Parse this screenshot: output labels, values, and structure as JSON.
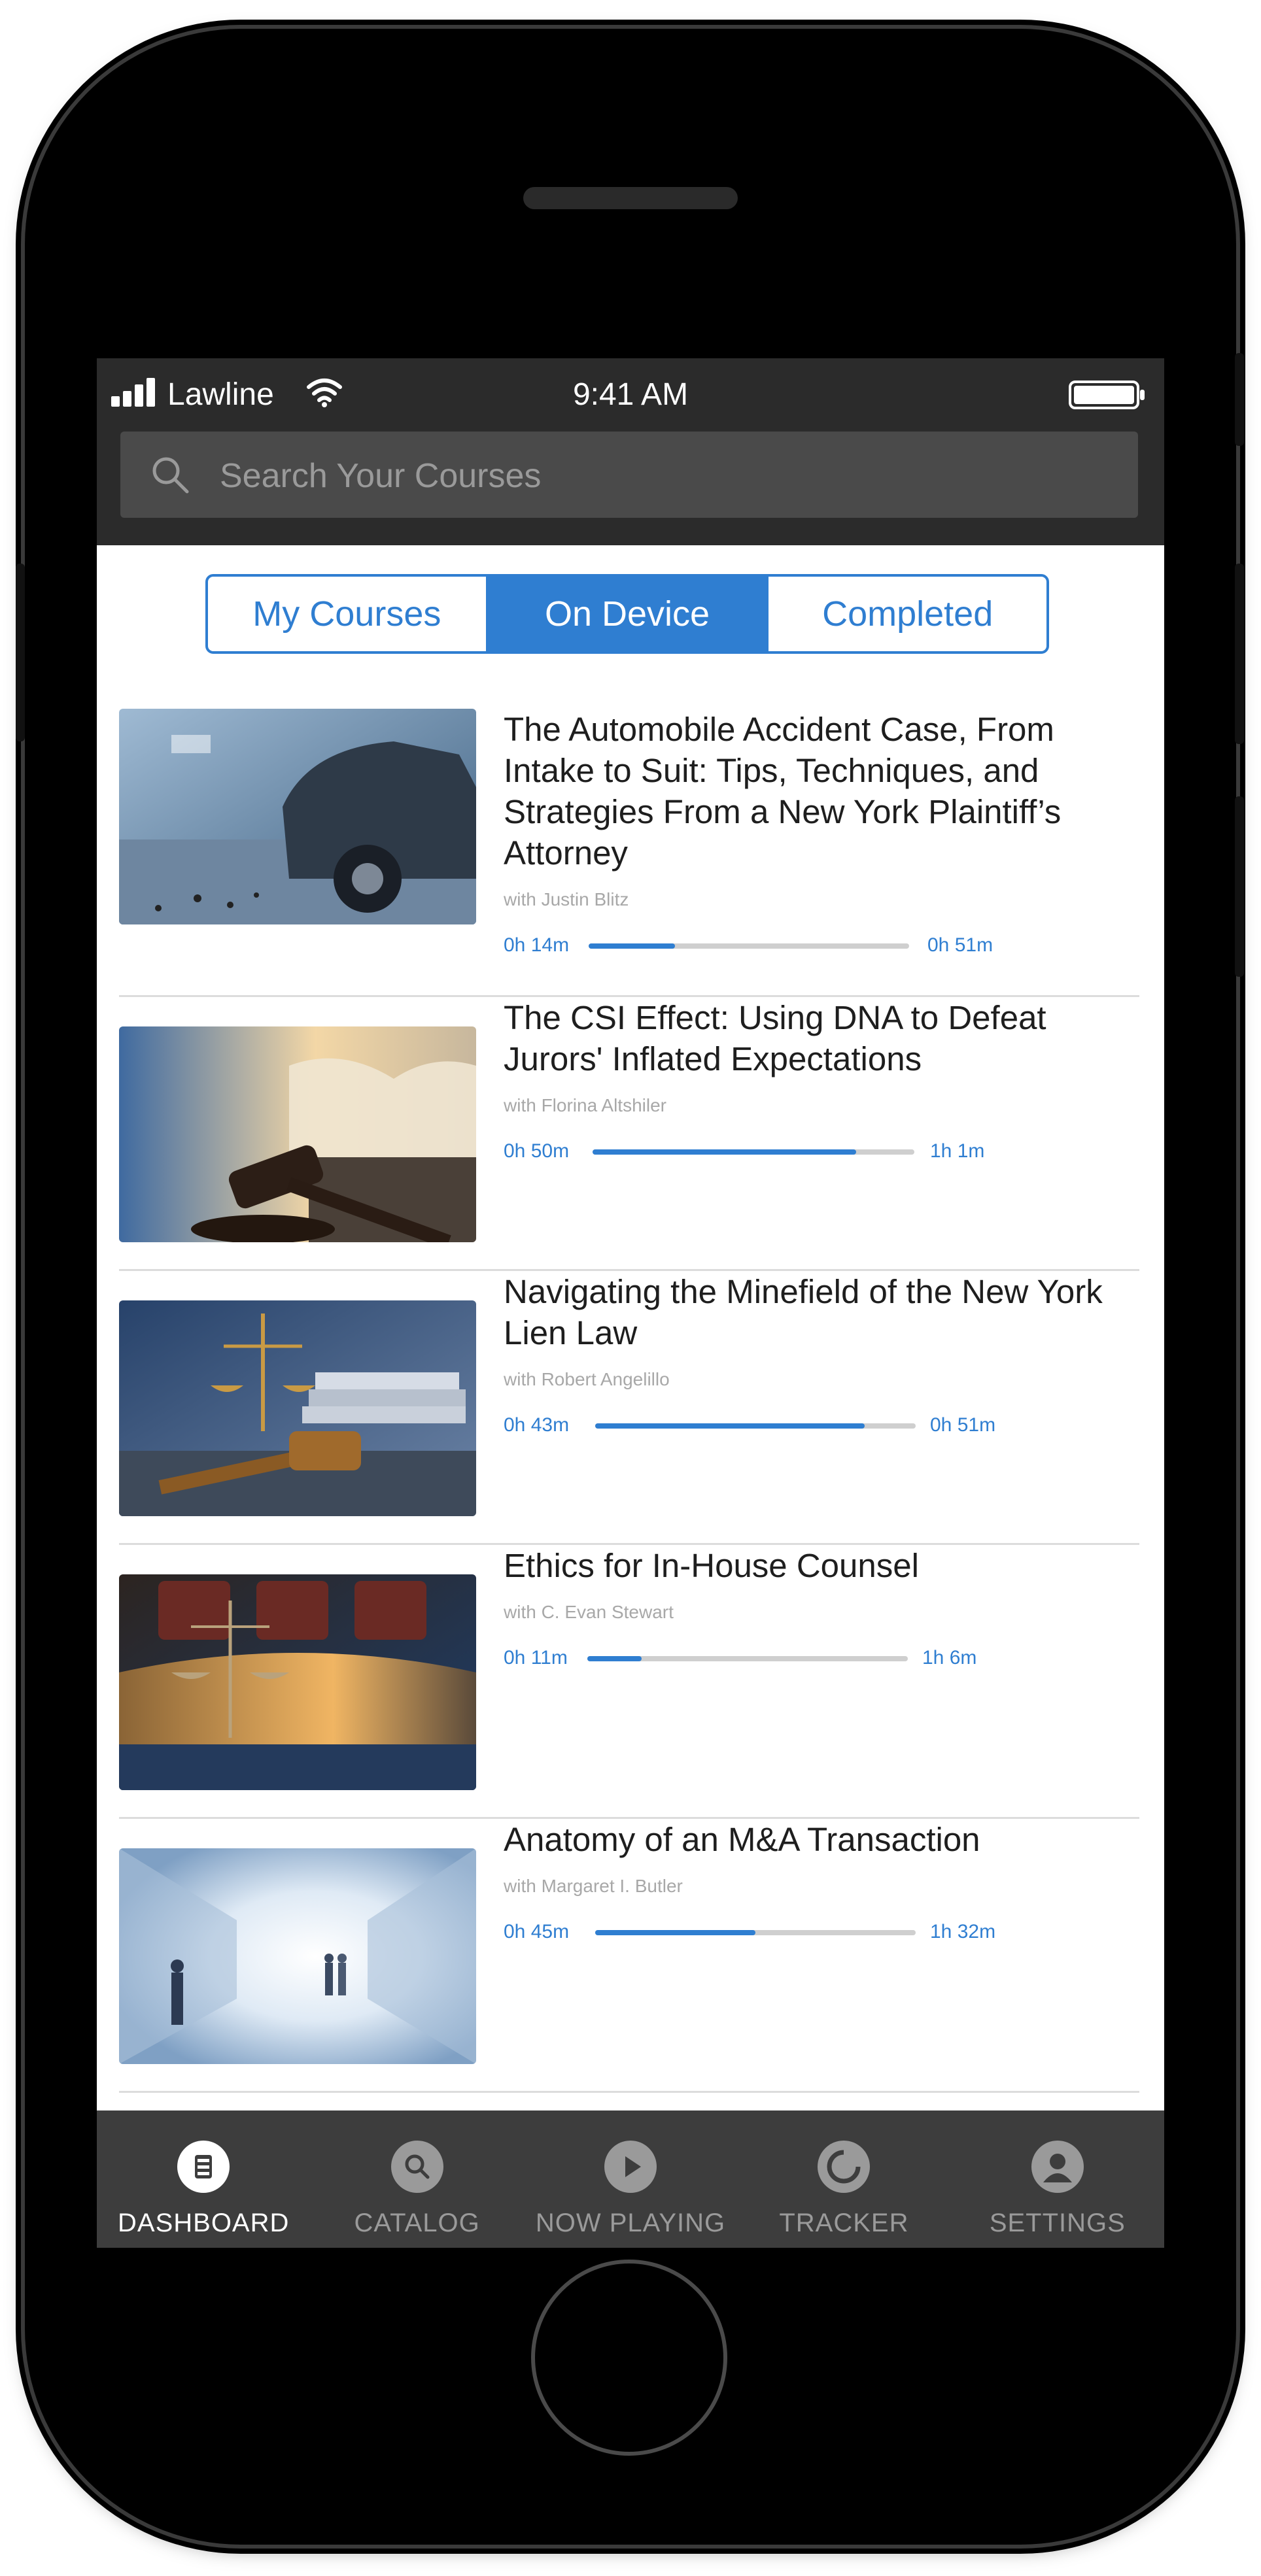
{
  "status_bar": {
    "carrier": "Lawline",
    "time": "9:41 AM"
  },
  "search": {
    "placeholder": "Search Your Courses"
  },
  "segments": [
    {
      "label": "My Courses",
      "active": false
    },
    {
      "label": "On Device",
      "active": true
    },
    {
      "label": "Completed",
      "active": false
    }
  ],
  "courses": [
    {
      "title": "The Automobile Accident Case, From Intake to Suit: Tips, Techniques, and Strategies From a New York Plaintiff’s Attorney",
      "author": "with Justin Blitz",
      "elapsed": "0h 14m",
      "total": "0h 51m",
      "progress": 0.27,
      "thumbnail": "car-crash-image"
    },
    {
      "title": "The CSI Effect: Using DNA to Defeat Jurors' Inflated Expectations",
      "author": "with Florina Altshiler",
      "elapsed": "0h 50m",
      "total": "1h 1m",
      "progress": 0.82,
      "thumbnail": "gavel-book-image"
    },
    {
      "title": "Navigating the Minefield of the New York Lien Law",
      "author": "with Robert Angelillo",
      "elapsed": "0h 43m",
      "total": "0h 51m",
      "progress": 0.84,
      "thumbnail": "scales-gavel-image"
    },
    {
      "title": "Ethics for In-House Counsel",
      "author": "with C. Evan Stewart",
      "elapsed": "0h 11m",
      "total": "1h 6m",
      "progress": 0.17,
      "thumbnail": "scales-courtroom-image"
    },
    {
      "title": "Anatomy of an M&A Transaction",
      "author": "with Margaret I. Butler",
      "elapsed": "0h 45m",
      "total": "1h 32m",
      "progress": 0.5,
      "thumbnail": "corridor-people-image"
    }
  ],
  "tab_bar": [
    {
      "label": "DASHBOARD",
      "icon": "dashboard-icon",
      "active": true
    },
    {
      "label": "CATALOG",
      "icon": "catalog-search-icon",
      "active": false
    },
    {
      "label": "NOW PLAYING",
      "icon": "play-icon",
      "active": false
    },
    {
      "label": "TRACKER",
      "icon": "tracker-icon",
      "active": false
    },
    {
      "label": "SETTINGS",
      "icon": "user-icon",
      "active": false
    }
  ],
  "colors": {
    "accent": "#2f7ed1",
    "bar_dark": "#2b2b2b",
    "tab_bar": "#3d3d3d"
  }
}
